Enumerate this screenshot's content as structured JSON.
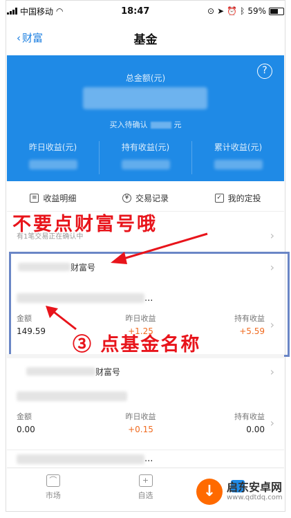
{
  "status_bar": {
    "carrier": "中国移动",
    "time": "18:47",
    "battery": "59%"
  },
  "nav": {
    "back_label": "财富",
    "title": "基金"
  },
  "summary": {
    "total_label": "总金额(元)",
    "pending_prefix": "买入待确认",
    "pending_suffix": "元",
    "stats": [
      "昨日收益(元)",
      "持有收益(元)",
      "累计收益(元)"
    ],
    "help_icon": "?"
  },
  "quick_links": [
    {
      "icon": "list-icon",
      "label": "收益明细"
    },
    {
      "icon": "yen-circle-icon",
      "label": "交易记录"
    },
    {
      "icon": "calendar-icon",
      "label": "我的定投"
    }
  ],
  "pending_row": "有1笔交易正在确认中",
  "annotation_top": "不要点财富号哦",
  "group1": {
    "wealth_label": "财富号",
    "fund_suffix": "...",
    "labels": [
      "金额",
      "昨日收益",
      "持有收益"
    ],
    "values": [
      "149.59",
      "+1.25",
      "+5.59"
    ]
  },
  "annotation_bottom": "③ 点基金名称",
  "group2": {
    "wealth_label": "财富号",
    "labels": [
      "金额",
      "昨日收益",
      "持有收益"
    ],
    "values": [
      "0.00",
      "+0.15",
      "0.00"
    ]
  },
  "group3": {
    "fund_suffix": "..."
  },
  "tabbar": [
    {
      "label": "市场",
      "icon": "market-icon"
    },
    {
      "label": "自选",
      "icon": "favorite-icon"
    },
    {
      "label": "",
      "icon": "holdings-icon"
    }
  ],
  "watermark": {
    "name": "启东安卓网",
    "url": "www.qdtdq.com"
  },
  "colors": {
    "primary": "#1f8ae6",
    "annotation": "#e8141b",
    "gain": "#f06a1f",
    "highlight": "#6a86c6"
  }
}
